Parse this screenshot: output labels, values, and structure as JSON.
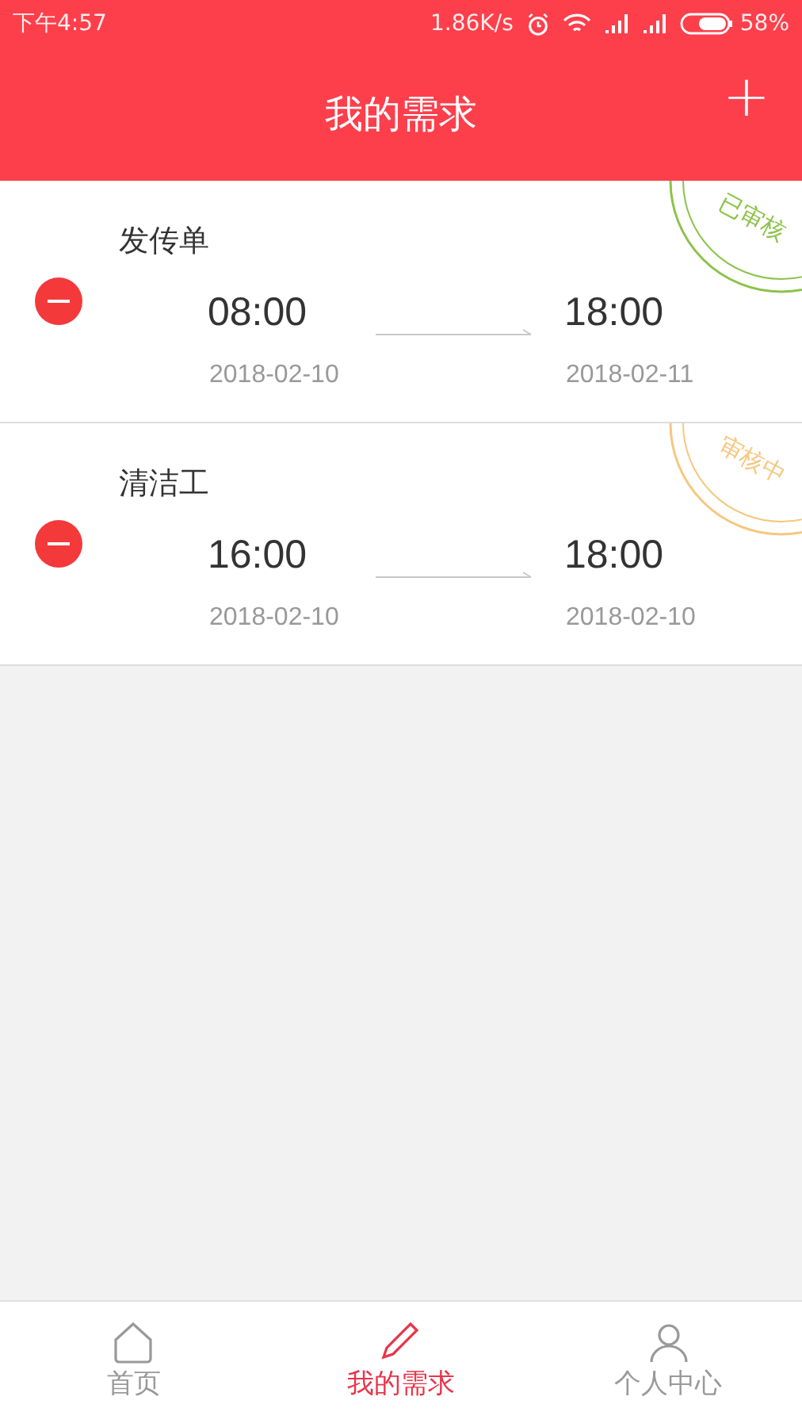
{
  "status_bar": {
    "time": "下午4:57",
    "speed": "1.86K/s",
    "battery": "58%"
  },
  "header": {
    "title": "我的需求",
    "add": "+"
  },
  "demands": [
    {
      "title": "发传单",
      "start_time": "08:00",
      "start_date": "2018-02-10",
      "end_time": "18:00",
      "end_date": "2018-02-11",
      "stamp": "已审核",
      "color": "#8bc34a"
    },
    {
      "title": "清洁工",
      "start_time": "16:00",
      "start_date": "2018-02-10",
      "end_time": "18:00",
      "end_date": "2018-02-10",
      "stamp": "审核中",
      "color": "#f5c77e"
    }
  ],
  "nav": [
    {
      "kind": "home",
      "label": "首页",
      "selected": false
    },
    {
      "kind": "edit",
      "label": "我的需求",
      "selected": true
    },
    {
      "kind": "user",
      "label": "个人中心",
      "selected": false
    }
  ]
}
